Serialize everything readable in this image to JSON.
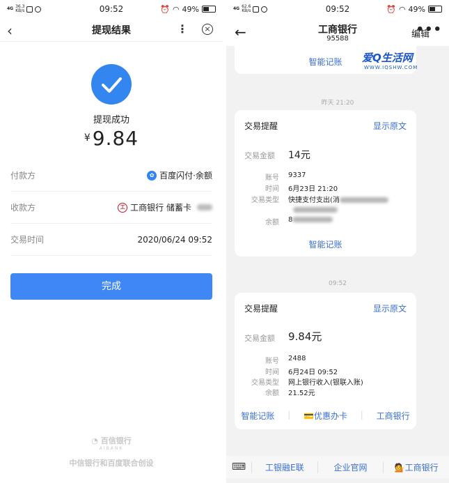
{
  "left": {
    "status": {
      "signal": "4G",
      "speed_top": "36.3",
      "speed_bottom": "KB/s",
      "time": "09:52",
      "battery": "49%"
    },
    "nav": {
      "back": "‹",
      "title": "提现结果",
      "more": "⋮",
      "close": "×"
    },
    "result": {
      "label": "提现成功",
      "currency": "¥",
      "amount": "9.84"
    },
    "rows": [
      {
        "key": "付款方",
        "value": "百度闪付·余额"
      },
      {
        "key": "收款方",
        "value": "工商银行 储蓄卡"
      },
      {
        "key": "交易时间",
        "value": "2020/06/24 09:52"
      }
    ],
    "done_button": "完成",
    "footer": {
      "brand": "百信银行",
      "brand_en": "AIBANK",
      "text": "中信银行和百度联合创设"
    }
  },
  "right": {
    "status": {
      "signal": "4G",
      "speed_top": "62.6",
      "speed_bottom": "KB/s",
      "time": "09:52",
      "battery": "49%"
    },
    "nav": {
      "back": "←",
      "title": "工商银行",
      "subtitle": "95588",
      "edit": "编辑",
      "more": "•••"
    },
    "watermark": {
      "main": "爱Q生活网",
      "sub": "WWW.IQSHW.COM"
    },
    "card_top": {
      "smart": "智能记账"
    },
    "time_1": "昨天 21:20",
    "msg1": {
      "title": "交易提醒",
      "link": "显示原文",
      "amount_key": "交易金额",
      "amount": "14元",
      "account_key": "账号",
      "account": "9337",
      "time_key": "时间",
      "time": "6月23日 21:20",
      "type_key": "交易类型",
      "type": "快捷支付支出(消",
      "balance_key": "余额",
      "balance": "8",
      "smart": "智能记账"
    },
    "time_2": "09:52",
    "msg2": {
      "title": "交易提醒",
      "link": "显示原文",
      "amount_key": "交易金额",
      "amount": "9.84元",
      "account_key": "账号",
      "account": "2488",
      "time_key": "时间",
      "time": "6月24日 09:52",
      "type_key": "交易类型",
      "type": "网上银行收入(银联入账)",
      "balance_key": "余额",
      "balance": "21.52元",
      "actions": [
        "智能记账",
        "💳优惠办卡",
        "工商银行"
      ]
    },
    "bottom": {
      "keyboard": "⌨",
      "items": [
        "工银融E联",
        "企业官网",
        "💁工商银行"
      ]
    }
  }
}
